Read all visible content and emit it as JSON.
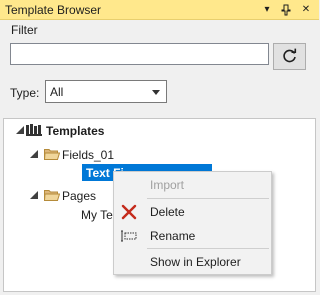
{
  "window": {
    "title": "Template Browser"
  },
  "titlebar_icons": [
    "dropdown-icon",
    "pin-icon",
    "close-icon"
  ],
  "filter": {
    "label": "Filter",
    "search_value": "",
    "refresh_icon": "refresh-icon"
  },
  "type": {
    "label": "Type:",
    "selected": "All"
  },
  "tree": {
    "root": {
      "label": "Templates",
      "icon": "library-icon"
    },
    "fields_folder": {
      "label": "Fields_01"
    },
    "selected_item": {
      "label": "Text Fi"
    },
    "pages_folder": {
      "label": "Pages"
    },
    "pages_child": {
      "label": "My Tex"
    }
  },
  "context_menu": {
    "items": [
      {
        "label": "Import",
        "enabled": false
      },
      {
        "label": "Delete",
        "enabled": true,
        "icon": "delete-x-icon"
      },
      {
        "label": "Rename",
        "enabled": true,
        "icon": "rename-icon"
      },
      {
        "label": "Show in Explorer",
        "enabled": true
      }
    ]
  },
  "colors": {
    "title_bar": "#ffe88c",
    "selection": "#0078d7",
    "delete_icon": "#c42b1c"
  }
}
